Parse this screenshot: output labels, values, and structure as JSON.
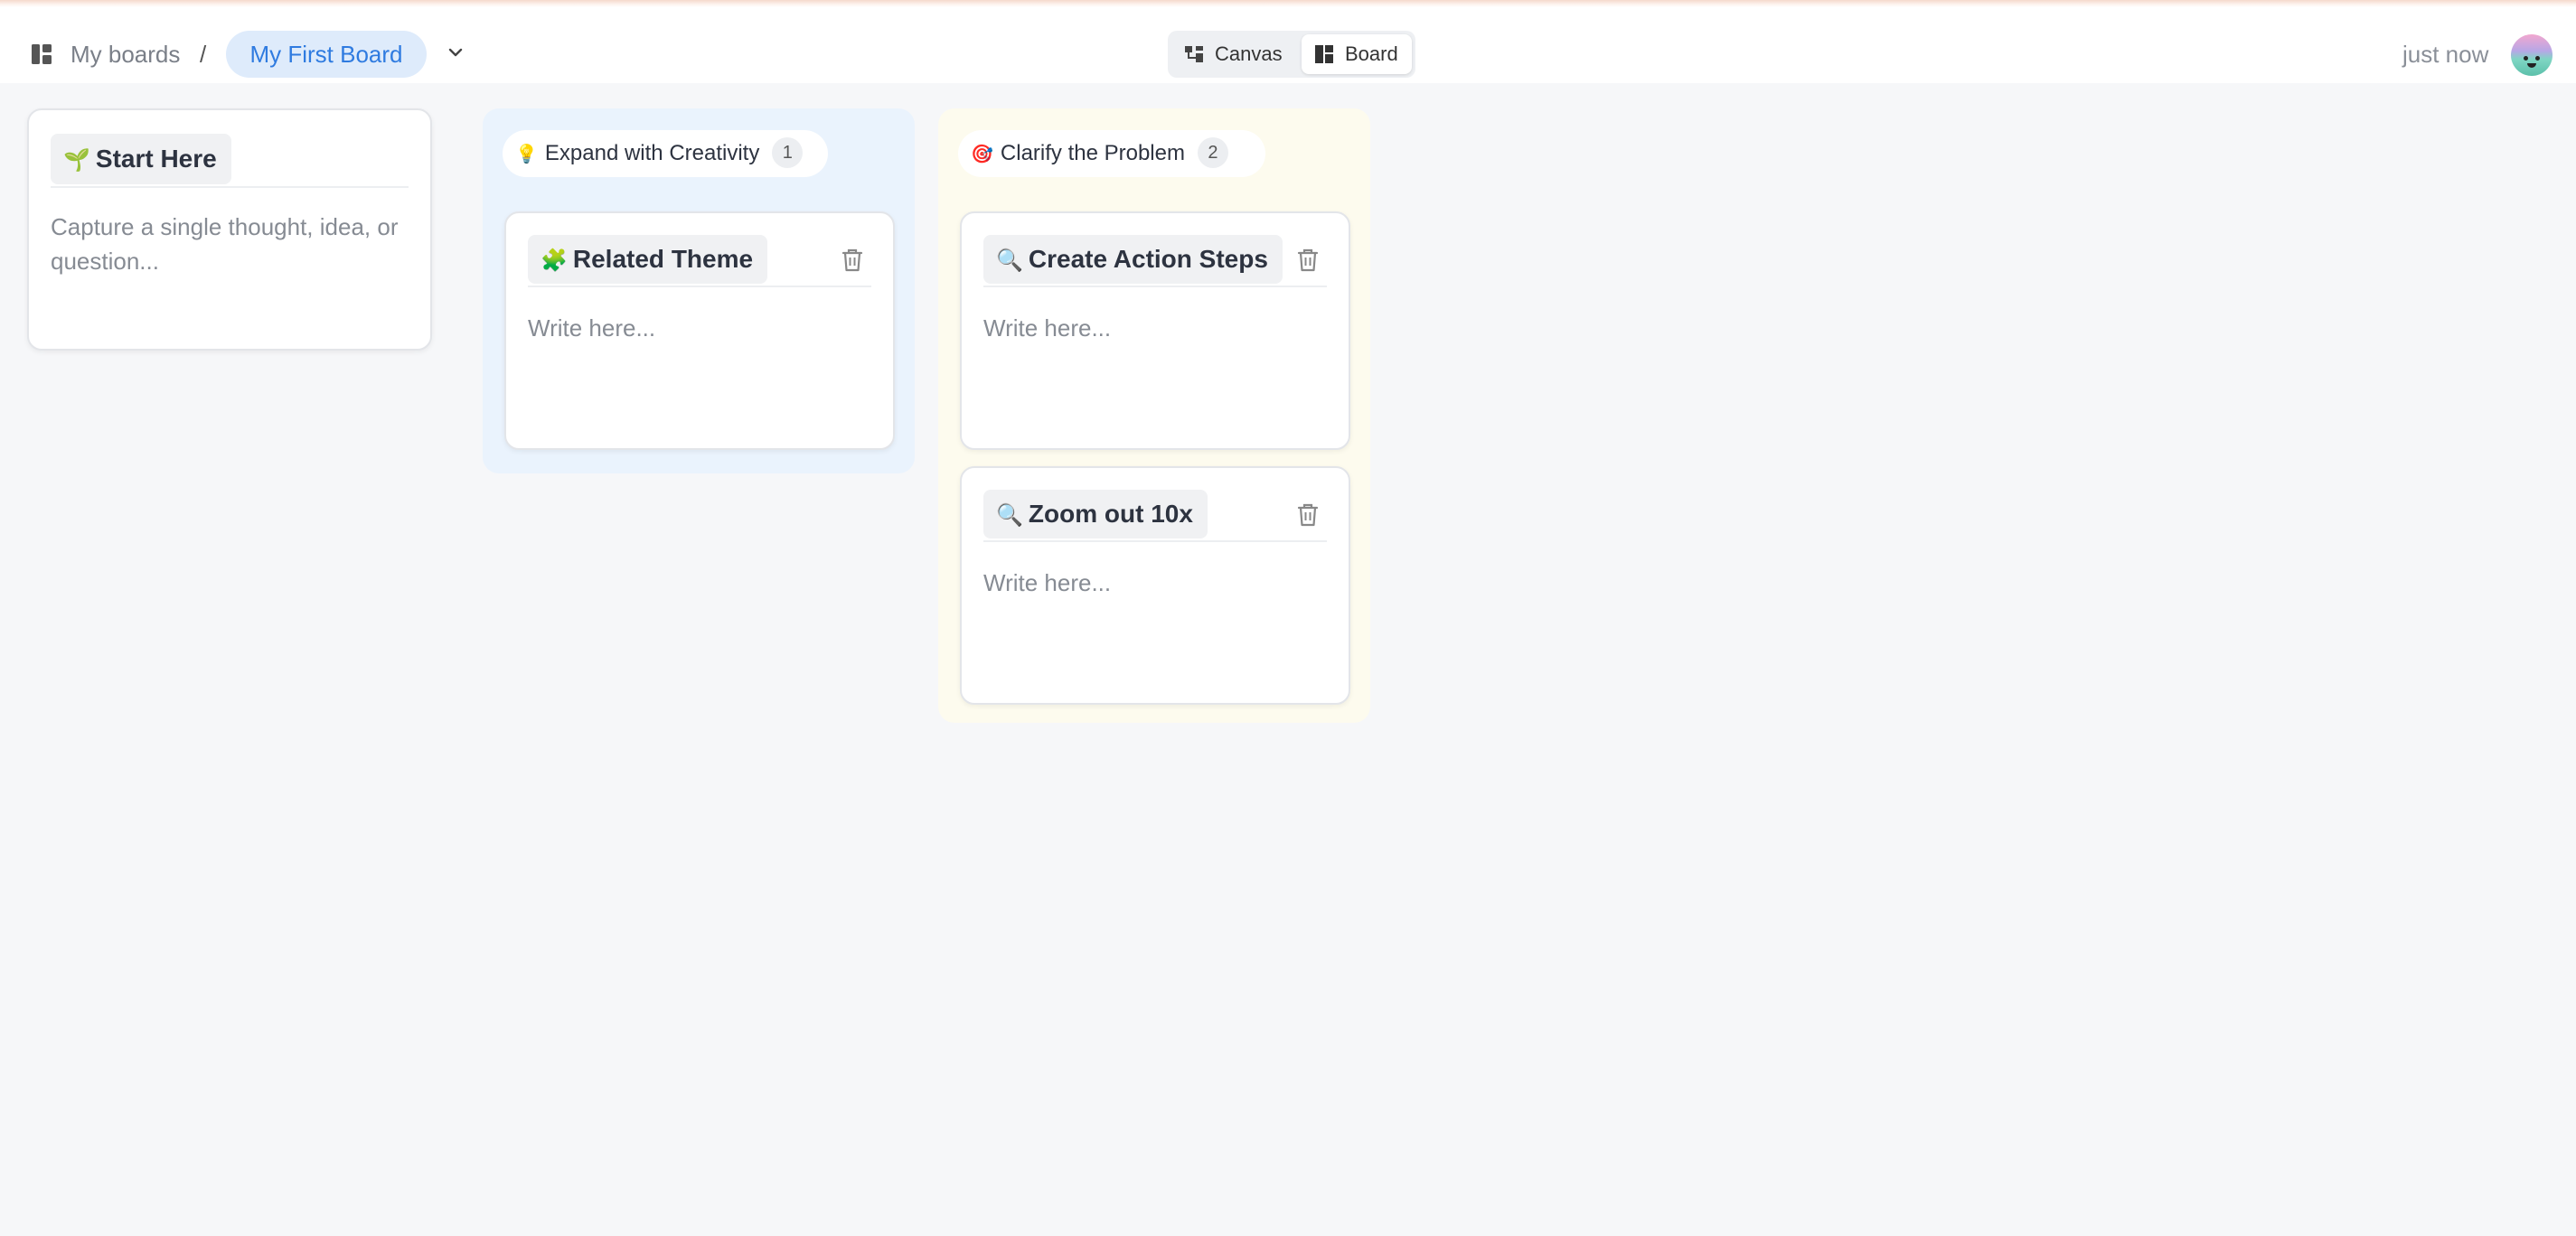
{
  "header": {
    "breadcrumb_root": "My boards",
    "separator": "/",
    "board_name": "My First Board",
    "views": [
      {
        "label": "Canvas",
        "icon": "canvas-icon"
      },
      {
        "label": "Board",
        "icon": "board-icon",
        "selected": true
      }
    ],
    "saved_status": "just now"
  },
  "start_card": {
    "emoji": "🌱",
    "title": "Start Here",
    "body": "Capture a single thought, idea, or question..."
  },
  "columns": [
    {
      "emoji": "💡",
      "title": "Expand with Creativity",
      "count": "1",
      "color": "#eaf3fd",
      "cards": [
        {
          "emoji": "🧩",
          "title": "Related Theme",
          "body": "Write here..."
        }
      ]
    },
    {
      "emoji": "🎯",
      "title": "Clarify the Problem",
      "count": "2",
      "color": "#fdfbee",
      "cards": [
        {
          "emoji": "🔍",
          "title": "Create Action Steps",
          "body": "Write here..."
        },
        {
          "emoji": "🔍",
          "title": "Zoom out 10x",
          "body": "Write here..."
        }
      ]
    }
  ]
}
